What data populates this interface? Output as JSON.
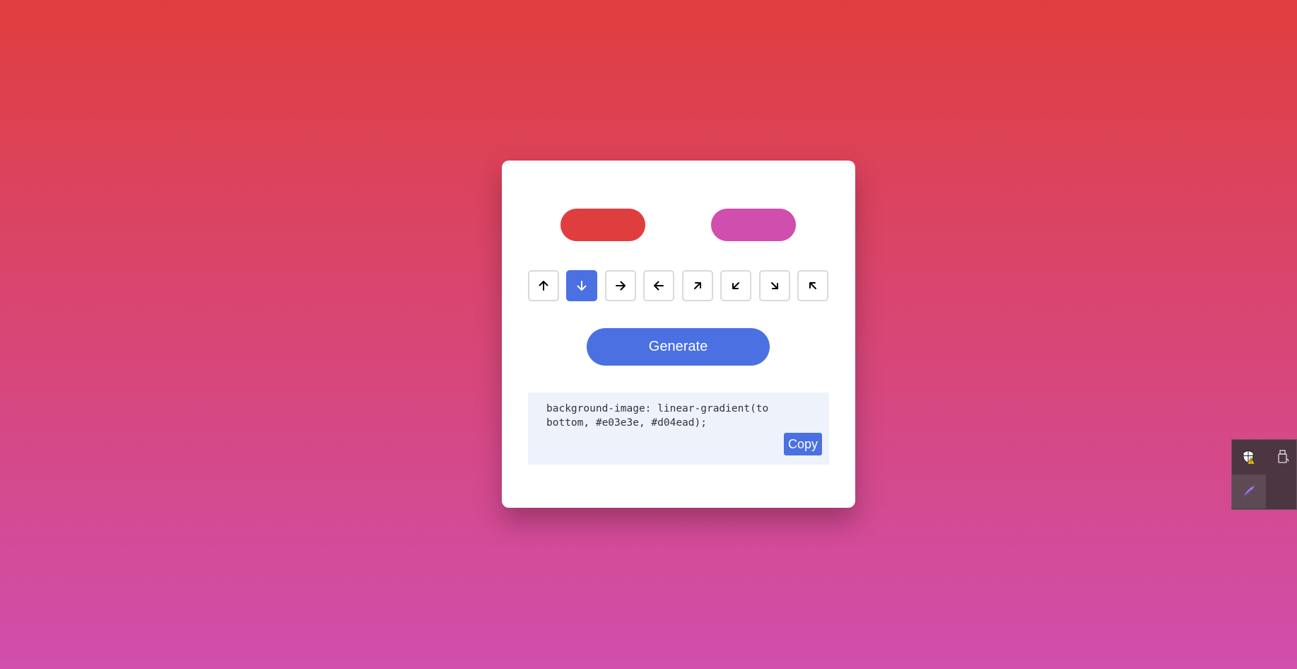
{
  "colors": {
    "color_start": "#e03e3e",
    "color_end": "#d04ead",
    "accent": "#4a70e2"
  },
  "directions": [
    {
      "icon": "arrow-up-icon",
      "value": "to top",
      "active": false
    },
    {
      "icon": "arrow-down-icon",
      "value": "to bottom",
      "active": true
    },
    {
      "icon": "arrow-right-icon",
      "value": "to right",
      "active": false
    },
    {
      "icon": "arrow-left-icon",
      "value": "to left",
      "active": false
    },
    {
      "icon": "arrow-up-right-icon",
      "value": "to top right",
      "active": false
    },
    {
      "icon": "arrow-down-left-icon",
      "value": "to bottom left",
      "active": false
    },
    {
      "icon": "arrow-down-right-icon",
      "value": "to bottom right",
      "active": false
    },
    {
      "icon": "arrow-up-left-icon",
      "value": "to top left",
      "active": false
    }
  ],
  "generate_label": "Generate",
  "output": {
    "code": "background-image: linear-gradient(to bottom, #e03e3e, #d04ead);",
    "copy_label": "Copy"
  },
  "tray": {
    "icons": [
      "security-shield-warning-icon",
      "usb-drive-icon",
      "feather-pen-icon"
    ]
  }
}
